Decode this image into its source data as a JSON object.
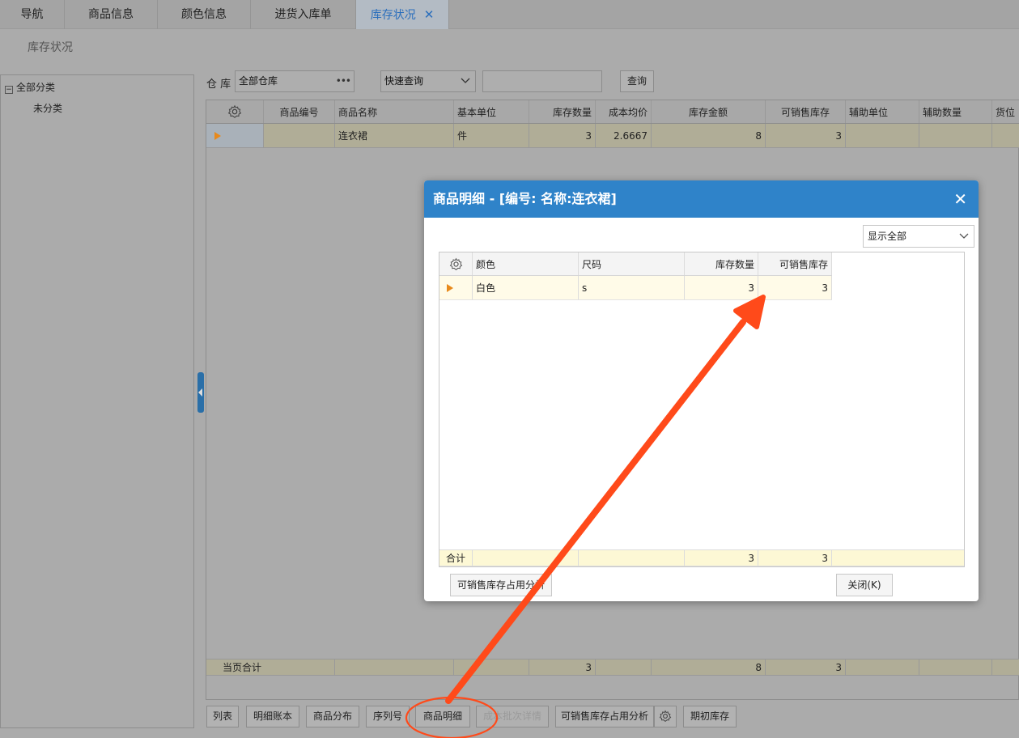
{
  "tabs": [
    {
      "label": "导航",
      "active": false
    },
    {
      "label": "商品信息",
      "active": false
    },
    {
      "label": "颜色信息",
      "active": false
    },
    {
      "label": "进货入库单",
      "active": false
    },
    {
      "label": "库存状况",
      "active": true,
      "close": "✕"
    }
  ],
  "page_title": "库存状况",
  "tree": {
    "root": "全部分类",
    "toggle": "−",
    "child": "未分类"
  },
  "filter": {
    "warehouse_label": "仓 库",
    "warehouse_value": "全部仓库",
    "warehouse_more": "•••",
    "quick_search": "快速查询",
    "query_button": "查询"
  },
  "grid": {
    "columns": [
      "商品编号",
      "商品名称",
      "基本单位",
      "库存数量",
      "成本均价",
      "库存金额",
      "可销售库存",
      "辅助单位",
      "辅助数量",
      "货位"
    ],
    "rows": [
      {
        "code": "",
        "name": "连衣裙",
        "unit": "件",
        "qty": "3",
        "avg_cost": "2.6667",
        "amount": "8",
        "sellable": "3",
        "aux_unit": "",
        "aux_qty": ""
      }
    ],
    "footer": {
      "label": "当页合计",
      "qty": "3",
      "amount": "8",
      "sellable": "3"
    }
  },
  "toolbar": {
    "list": "列表",
    "detail_ledger": "明细账本",
    "distribution": "商品分布",
    "serial": "序列号",
    "product_detail": "商品明细",
    "batch_detail": "成本批次详情",
    "sellable_analysis": "可销售库存占用分析",
    "opening_stock": "期初库存"
  },
  "modal": {
    "title": "商品明细 - [编号: 名称:连衣裙]",
    "close": "✕",
    "filter_select": "显示全部",
    "columns": [
      "颜色",
      "尺码",
      "库存数量",
      "可销售库存"
    ],
    "rows": [
      {
        "color": "白色",
        "size": "s",
        "qty": "3",
        "sellable": "3"
      }
    ],
    "footer": {
      "label": "合计",
      "qty": "3",
      "sellable": "3"
    },
    "left_button": "可销售库存占用分析",
    "close_button": "关闭(K)"
  },
  "colors": {
    "annotation": "#ff4a1a",
    "modal_header": "#2f83c9",
    "active_tab_text": "#2a6ebc",
    "row_marker": "#e8891b"
  }
}
